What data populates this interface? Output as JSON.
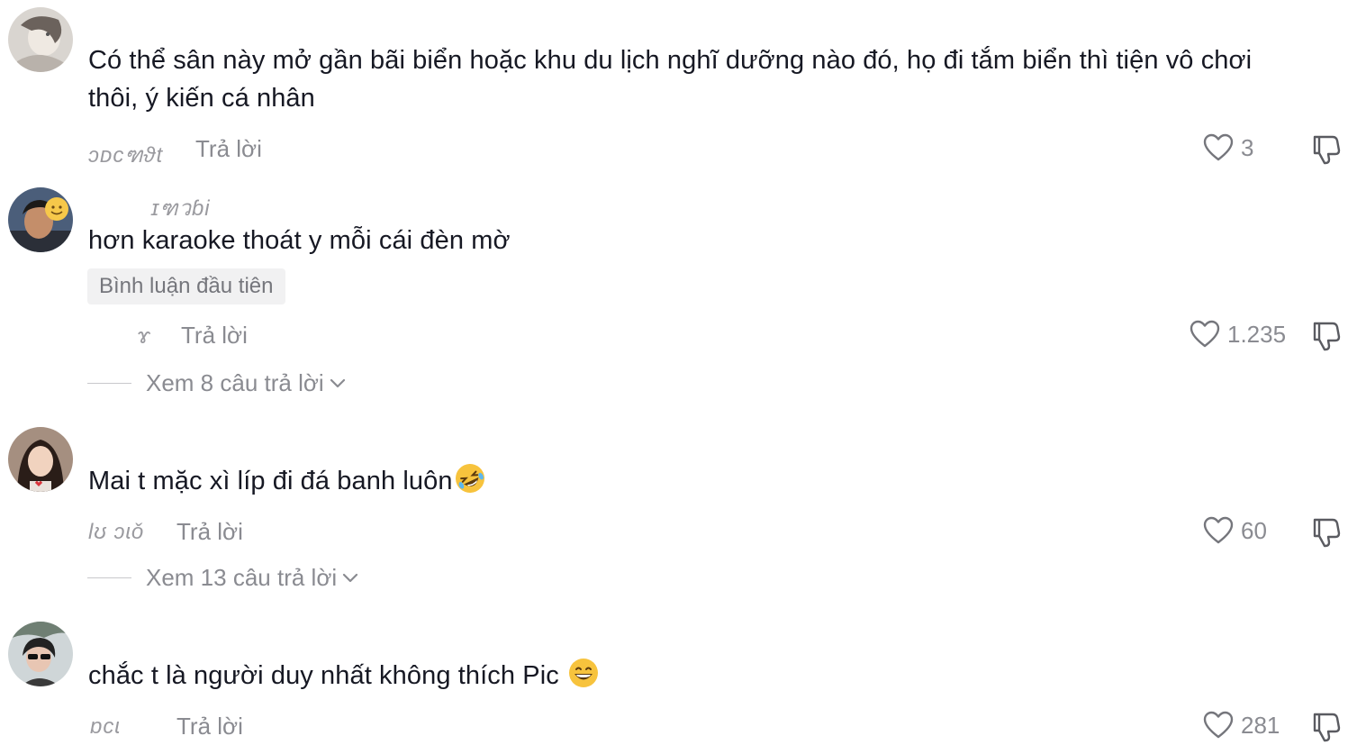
{
  "comments": [
    {
      "text": "Có thể sân này mở gần bãi biển hoặc khu du lịch nghĩ dưỡng nào đó, họ đi tắm biển thì tiện vô chơi",
      "text_line2": "thôi, ý kiến cá nhân",
      "meta": "ɔᴅᴄฑϑt",
      "reply_label": "Trả lời",
      "likes": "3"
    },
    {
      "username": "ɪฑวɓi",
      "text": "hơn karaoke thoát y mỗi cái đèn mờ",
      "badge": "Bình luận đầu tiên",
      "meta": "ɤ",
      "reply_label": "Trả lời",
      "likes": "1.235",
      "view_replies": "Xem 8 câu trả lời"
    },
    {
      "text": "Mai t mặc xì líp đi đá banh luôn",
      "emoji": "rolling-on-floor-laughing",
      "meta": "ɫʊ ɔɩǒ",
      "reply_label": "Trả lời",
      "likes": "60",
      "view_replies": "Xem 13 câu trả lời"
    },
    {
      "text": "chắc t là người duy nhất không thích Pic",
      "emoji": "grinning-face",
      "meta": "ɒᴄɩ",
      "reply_label": "Trả lời",
      "likes": "281"
    }
  ],
  "colors": {
    "text": "#161823",
    "muted": "#8a8b91",
    "badge_bg": "#f1f1f2"
  }
}
